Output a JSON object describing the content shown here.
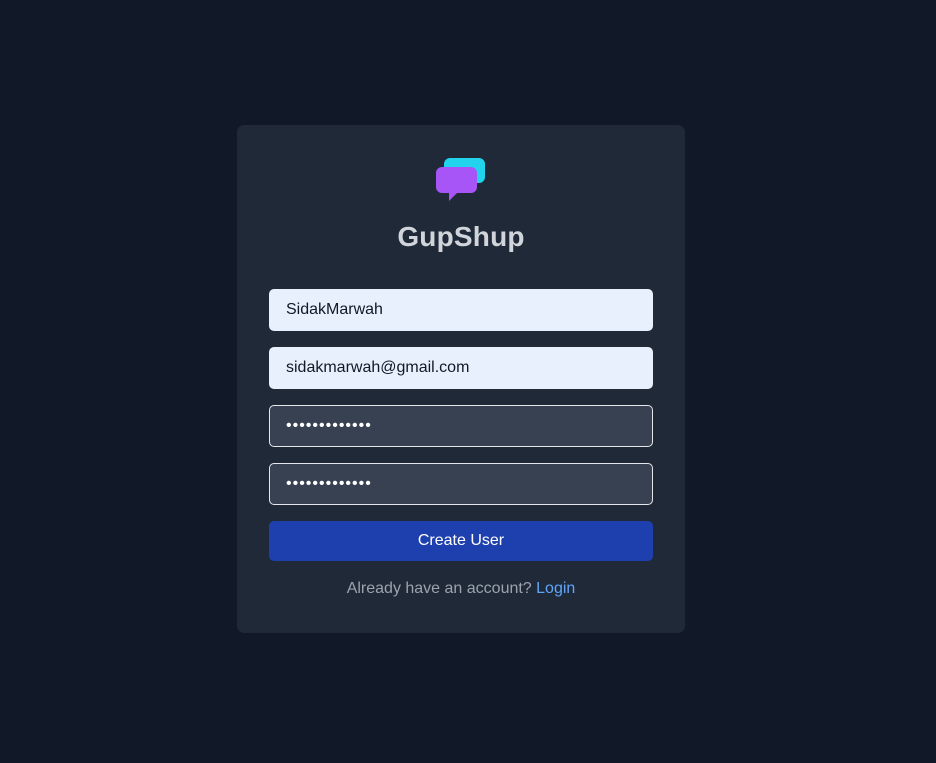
{
  "app": {
    "name": "GupShup",
    "logo_icon": "chat-bubbles-icon",
    "colors": {
      "background": "#111827",
      "card": "#1f2937",
      "primary_button": "#1e40af",
      "link": "#60a5fa",
      "logo_front": "#a855f7",
      "logo_back": "#22d3ee"
    }
  },
  "form": {
    "username": "SidakMarwah",
    "email": "sidakmarwah@gmail.com",
    "password": "•••••••••••••",
    "confirm_password": "•••••••••••••",
    "submit_label": "Create User"
  },
  "footer": {
    "prompt": "Already have an account?",
    "link_label": "Login"
  }
}
